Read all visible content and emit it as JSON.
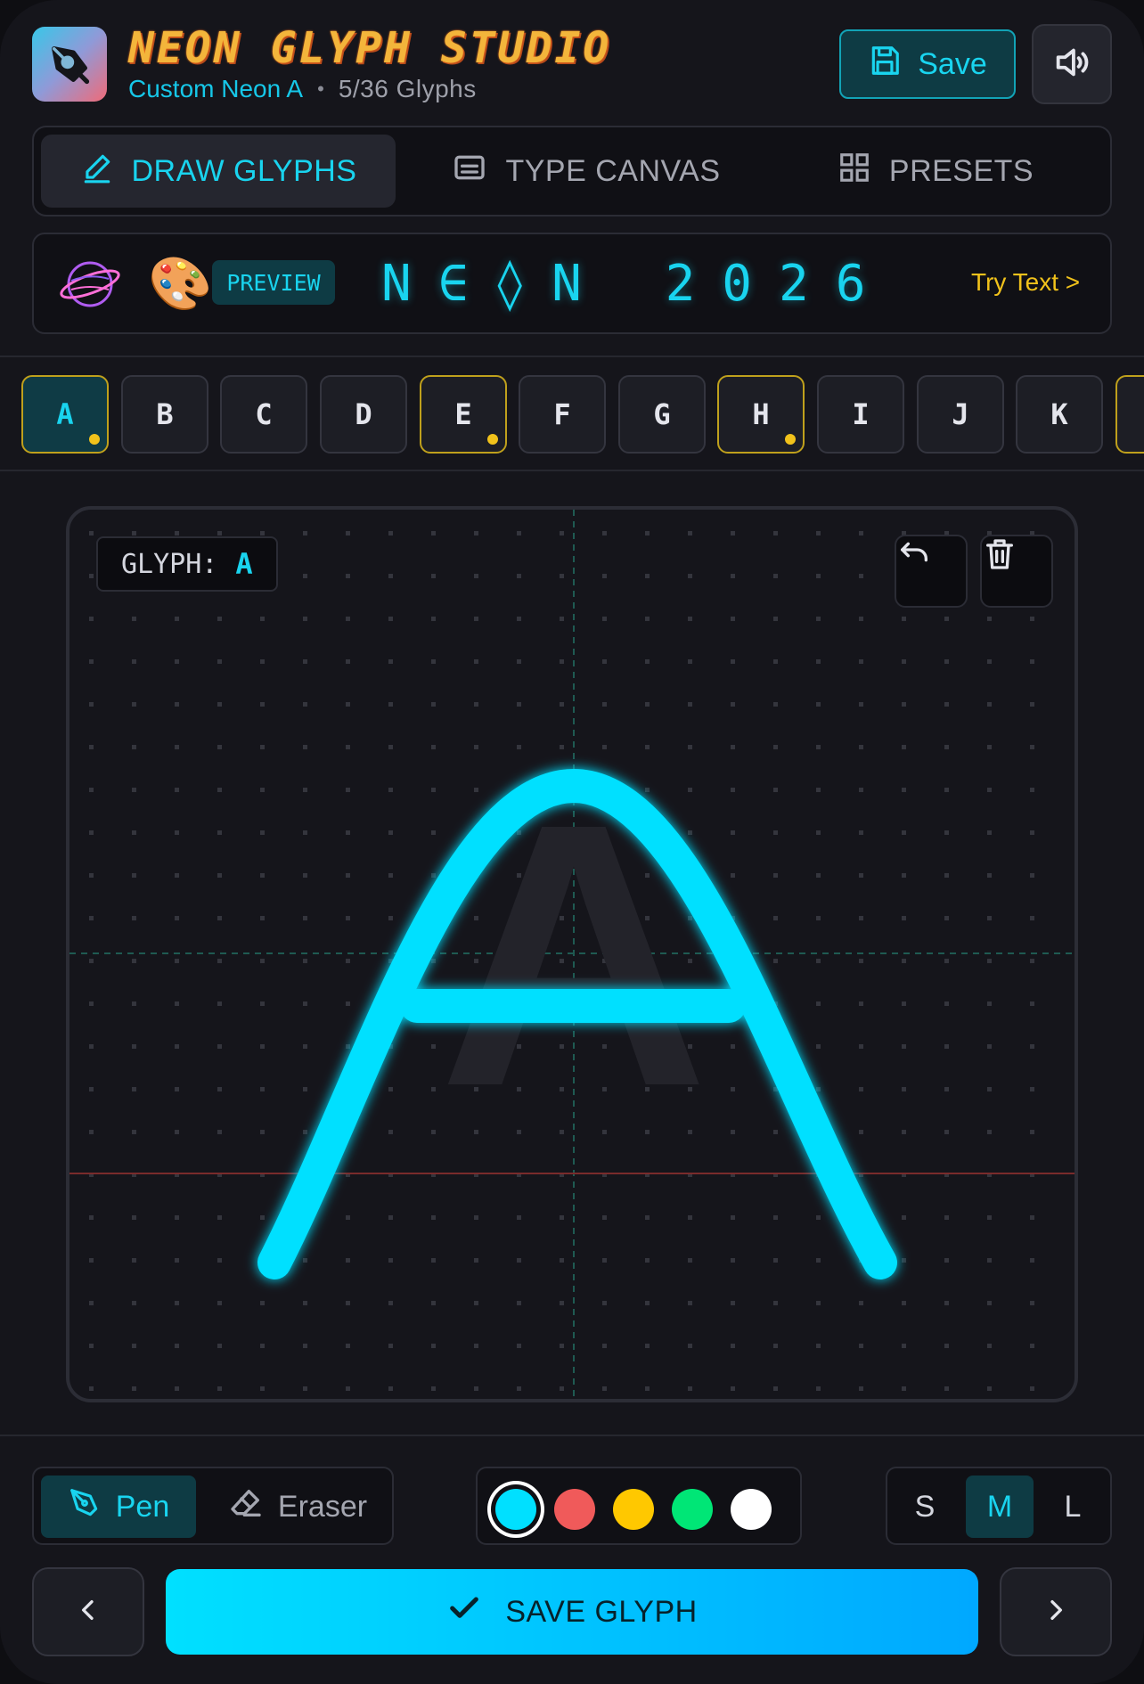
{
  "header": {
    "app_title": "NEON GLYPH STUDIO",
    "font_name": "Custom Neon A",
    "separator": "•",
    "glyph_count": "5/36 Glyphs",
    "save_label": "Save",
    "logo_icon": "pen-nib-icon",
    "sound_icon": "speaker-icon"
  },
  "tabs": [
    {
      "label": "DRAW GLYPHS",
      "icon": "pencil-icon",
      "active": true
    },
    {
      "label": "TYPE CANVAS",
      "icon": "keyboard-icon",
      "active": false
    },
    {
      "label": "PRESETS",
      "icon": "grid-icon",
      "active": false
    }
  ],
  "preview": {
    "emoji_planet": "planet-icon",
    "emoji_palette": "🎨",
    "badge": "PREVIEW",
    "text": "N∈◊N 2026",
    "try_text": "Try Text >"
  },
  "glyph_strip": {
    "keys": [
      {
        "label": "A",
        "done": true,
        "active": true
      },
      {
        "label": "B",
        "done": false,
        "active": false
      },
      {
        "label": "C",
        "done": false,
        "active": false
      },
      {
        "label": "D",
        "done": false,
        "active": false
      },
      {
        "label": "E",
        "done": true,
        "active": false
      },
      {
        "label": "F",
        "done": false,
        "active": false
      },
      {
        "label": "G",
        "done": false,
        "active": false
      },
      {
        "label": "H",
        "done": true,
        "active": false
      },
      {
        "label": "I",
        "done": false,
        "active": false
      },
      {
        "label": "J",
        "done": false,
        "active": false
      },
      {
        "label": "K",
        "done": false,
        "active": false
      }
    ]
  },
  "canvas": {
    "glyph_label": "GLYPH:",
    "current_glyph": "A",
    "ghost_letter": "A",
    "stroke_color": "#00e0ff",
    "undo_icon": "undo-icon",
    "clear_icon": "trash-icon"
  },
  "tools": {
    "pen_label": "Pen",
    "eraser_label": "Eraser",
    "active_tool": "Pen",
    "colors": [
      "#00e0ff",
      "#f05a5a",
      "#ffc800",
      "#00e676",
      "#ffffff"
    ],
    "selected_color": "#00e0ff",
    "sizes": [
      "S",
      "M",
      "L"
    ],
    "active_size": "M"
  },
  "footer": {
    "prev_icon": "chevron-left-icon",
    "next_icon": "chevron-right-icon",
    "save_glyph_label": "SAVE GLYPH"
  },
  "colors": {
    "accent": "#19d4ef",
    "gold": "#f1c21b",
    "background": "#15151b"
  }
}
